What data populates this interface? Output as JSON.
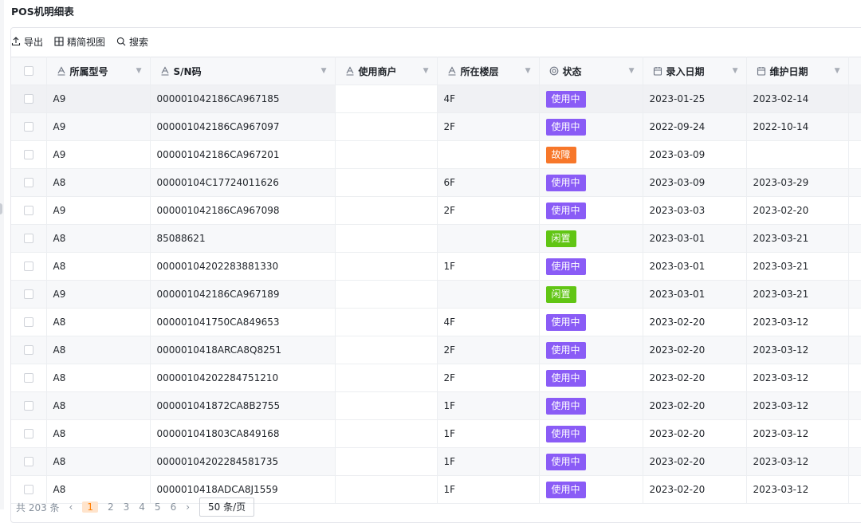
{
  "page": {
    "title": "POS机明细表"
  },
  "toolbar": {
    "export": "导出",
    "view": "精简视图",
    "search": "搜索"
  },
  "colors": {
    "inuse": "#8a5cf6",
    "fault": "#f7772a",
    "idle": "#61c514"
  },
  "columns": [
    {
      "label": "所属型号",
      "icon": "text-field-icon"
    },
    {
      "label": "S/N码",
      "icon": "text-field-icon"
    },
    {
      "label": "使用商户",
      "icon": "text-field-icon"
    },
    {
      "label": "所在楼层",
      "icon": "text-field-icon"
    },
    {
      "label": "状态",
      "icon": "status-field-icon"
    },
    {
      "label": "录入日期",
      "icon": "date-field-icon"
    },
    {
      "label": "维护日期",
      "icon": "date-field-icon"
    }
  ],
  "rows": [
    {
      "model": "A9",
      "sn": "000001042186CA967185",
      "merchant": "",
      "floor": "4F",
      "status": "使用中",
      "status_key": "inuse",
      "entry": "2023-01-25",
      "maint": "2023-02-14"
    },
    {
      "model": "A9",
      "sn": "000001042186CA967097",
      "merchant": "",
      "floor": "2F",
      "status": "使用中",
      "status_key": "inuse",
      "entry": "2022-09-24",
      "maint": "2022-10-14"
    },
    {
      "model": "A9",
      "sn": "000001042186CA967201",
      "merchant": "",
      "floor": "",
      "status": "故障",
      "status_key": "fault",
      "entry": "2023-03-09",
      "maint": ""
    },
    {
      "model": "A8",
      "sn": "00000104C17724011626",
      "merchant": "",
      "floor": "6F",
      "status": "使用中",
      "status_key": "inuse",
      "entry": "2023-03-09",
      "maint": "2023-03-29"
    },
    {
      "model": "A9",
      "sn": "000001042186CA967098",
      "merchant": "",
      "floor": "2F",
      "status": "使用中",
      "status_key": "inuse",
      "entry": "2023-03-03",
      "maint": "2023-02-20"
    },
    {
      "model": "A8",
      "sn": "85088621",
      "merchant": "",
      "floor": "",
      "status": "闲置",
      "status_key": "idle",
      "entry": "2023-03-01",
      "maint": "2023-03-21"
    },
    {
      "model": "A8",
      "sn": "00000104202283881330",
      "merchant": "",
      "floor": "1F",
      "status": "使用中",
      "status_key": "inuse",
      "entry": "2023-03-01",
      "maint": "2023-03-21"
    },
    {
      "model": "A9",
      "sn": "000001042186CA967189",
      "merchant": "",
      "floor": "",
      "status": "闲置",
      "status_key": "idle",
      "entry": "2023-03-01",
      "maint": "2023-03-21"
    },
    {
      "model": "A8",
      "sn": "000001041750CA849653",
      "merchant": "",
      "floor": "4F",
      "status": "使用中",
      "status_key": "inuse",
      "entry": "2023-02-20",
      "maint": "2023-03-12"
    },
    {
      "model": "A8",
      "sn": "0000010418ARCA8Q8251",
      "merchant": "",
      "floor": "2F",
      "status": "使用中",
      "status_key": "inuse",
      "entry": "2023-02-20",
      "maint": "2023-03-12"
    },
    {
      "model": "A8",
      "sn": "00000104202284751210",
      "merchant": "",
      "floor": "2F",
      "status": "使用中",
      "status_key": "inuse",
      "entry": "2023-02-20",
      "maint": "2023-03-12"
    },
    {
      "model": "A8",
      "sn": "000001041872CA8B2755",
      "merchant": "",
      "floor": "1F",
      "status": "使用中",
      "status_key": "inuse",
      "entry": "2023-02-20",
      "maint": "2023-03-12"
    },
    {
      "model": "A8",
      "sn": "000001041803CA849168",
      "merchant": "",
      "floor": "1F",
      "status": "使用中",
      "status_key": "inuse",
      "entry": "2023-02-20",
      "maint": "2023-03-12"
    },
    {
      "model": "A8",
      "sn": "00000104202284581735",
      "merchant": "",
      "floor": "1F",
      "status": "使用中",
      "status_key": "inuse",
      "entry": "2023-02-20",
      "maint": "2023-03-12"
    },
    {
      "model": "A8",
      "sn": "0000010418ADCA8J1559",
      "merchant": "",
      "floor": "1F",
      "status": "使用中",
      "status_key": "inuse",
      "entry": "2023-02-20",
      "maint": "2023-03-12"
    }
  ],
  "pagination": {
    "total": "共 203 条",
    "prev": "‹",
    "pages": [
      "1",
      "2",
      "3",
      "4",
      "5",
      "6"
    ],
    "next": "›",
    "page_size": "50 条/页"
  }
}
